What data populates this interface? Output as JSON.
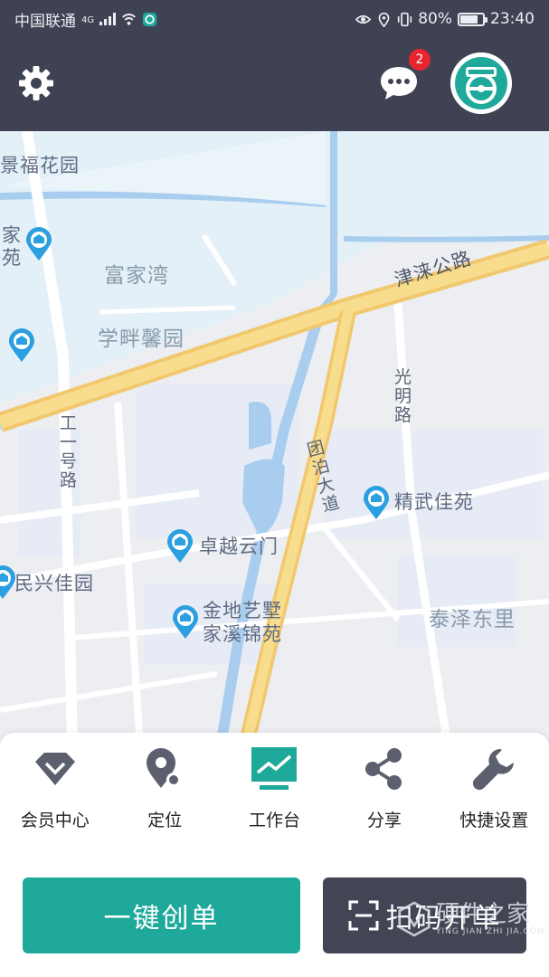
{
  "status": {
    "carrier": "中国联通",
    "network": "4G",
    "battery": "80%",
    "battery_level": 0.8,
    "time": "23:40"
  },
  "header": {
    "settings_icon": "gear-icon",
    "message_icon": "chat-bubble-icon",
    "message_count": "2",
    "avatar_icon": "steering-wheel-logo"
  },
  "map": {
    "labels": {
      "jingfu": "景福花园",
      "jia_a": "家",
      "jia_b": "苑",
      "fujiawan": "富家湾",
      "xuepan": "学畔馨园",
      "jinlai": "津涞公路",
      "guangming": "光明路",
      "gongyi": "工一号路",
      "tuanbo": "团泊大道",
      "jingwu": "精武佳苑",
      "zhuoyue": "卓越云门",
      "minxing": "民兴佳园",
      "jindi_1": "金地艺墅",
      "jindi_2": "家溪锦苑",
      "taize": "泰泽东里"
    }
  },
  "toolbar": {
    "items": [
      {
        "label": "会员中心",
        "icon": "diamond-icon"
      },
      {
        "label": "定位",
        "icon": "location-pin-icon"
      },
      {
        "label": "工作台",
        "icon": "dashboard-chart-icon"
      },
      {
        "label": "分享",
        "icon": "share-icon"
      },
      {
        "label": "快捷设置",
        "icon": "wrench-icon"
      }
    ]
  },
  "actions": {
    "create_label": "一键创单",
    "scan_label": "扫码开单"
  },
  "watermark": {
    "title": "硬件之家",
    "subtitle": "YING JIAN ZHI JIA.COM"
  },
  "colors": {
    "header_bg": "#3f4252",
    "primary": "#1fa99a",
    "dark_button": "#424554",
    "badge": "#e8242f",
    "road_main": "#f6d27a",
    "water": "#a9cdee"
  }
}
